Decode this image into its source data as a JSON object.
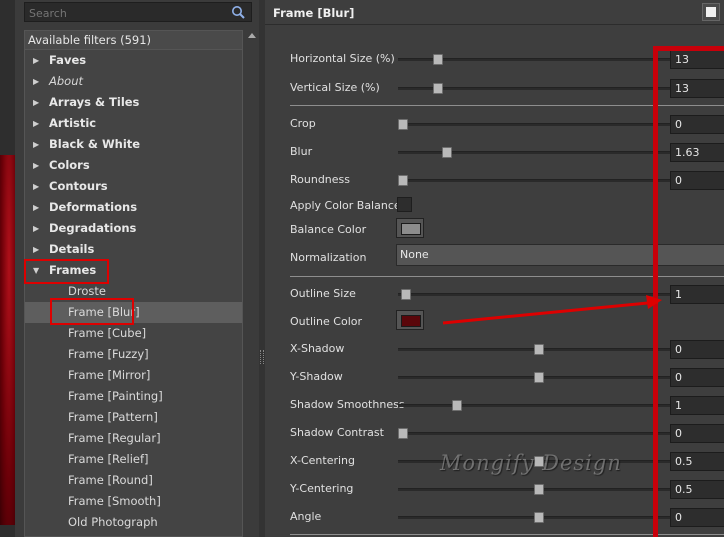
{
  "search": {
    "placeholder": "Search"
  },
  "filters": {
    "header": "Available filters (591)",
    "categories": [
      {
        "label": "Faves"
      },
      {
        "label": "About",
        "italic": true
      },
      {
        "label": "Arrays & Tiles"
      },
      {
        "label": "Artistic"
      },
      {
        "label": "Black & White"
      },
      {
        "label": "Colors"
      },
      {
        "label": "Contours"
      },
      {
        "label": "Deformations"
      },
      {
        "label": "Degradations"
      },
      {
        "label": "Details"
      },
      {
        "label": "Frames",
        "expanded": true
      }
    ],
    "frames_items": [
      {
        "label": "Droste"
      },
      {
        "label": "Frame [Blur]",
        "selected": true
      },
      {
        "label": "Frame [Cube]"
      },
      {
        "label": "Frame [Fuzzy]"
      },
      {
        "label": "Frame [Mirror]"
      },
      {
        "label": "Frame [Painting]"
      },
      {
        "label": "Frame [Pattern]"
      },
      {
        "label": "Frame [Regular]"
      },
      {
        "label": "Frame [Relief]"
      },
      {
        "label": "Frame [Round]"
      },
      {
        "label": "Frame [Smooth]"
      },
      {
        "label": "Old Photograph"
      }
    ]
  },
  "settings": {
    "title": "Frame [Blur]",
    "params": {
      "horizontal_size": {
        "label": "Horizontal Size (%)",
        "value": "13",
        "level": 0.13
      },
      "vertical_size": {
        "label": "Vertical Size (%)",
        "value": "13",
        "level": 0.13
      },
      "crop": {
        "label": "Crop",
        "value": "0",
        "level": 0.0
      },
      "blur": {
        "label": "Blur",
        "value": "1.63",
        "level": 0.163
      },
      "roundness": {
        "label": "Roundness",
        "value": "0",
        "level": 0.0
      },
      "apply_color_balance": {
        "label": "Apply Color Balance",
        "checked": false
      },
      "balance_color": {
        "label": "Balance Color",
        "color": "#8c8c8c"
      },
      "normalization": {
        "label": "Normalization",
        "value": "None"
      },
      "outline_size": {
        "label": "Outline Size",
        "value": "1",
        "level": 0.01
      },
      "outline_color": {
        "label": "Outline Color",
        "color": "#5a060a"
      },
      "x_shadow": {
        "label": "X-Shadow",
        "value": "0",
        "level": 0.5
      },
      "y_shadow": {
        "label": "Y-Shadow",
        "value": "0",
        "level": 0.5
      },
      "shadow_smoothness": {
        "label": "Shadow Smoothness",
        "value": "1",
        "level": 0.2
      },
      "shadow_contrast": {
        "label": "Shadow Contrast",
        "value": "0",
        "level": 0.0
      },
      "x_centering": {
        "label": "X-Centering",
        "value": "0.5",
        "level": 0.5
      },
      "y_centering": {
        "label": "Y-Centering",
        "value": "0.5",
        "level": 0.5
      },
      "angle": {
        "label": "Angle",
        "value": "0",
        "level": 0.5
      }
    }
  },
  "watermark": "Mongify Design",
  "colors": {
    "annotation_red": "#d00000",
    "canvas_red": "#b0101a"
  }
}
